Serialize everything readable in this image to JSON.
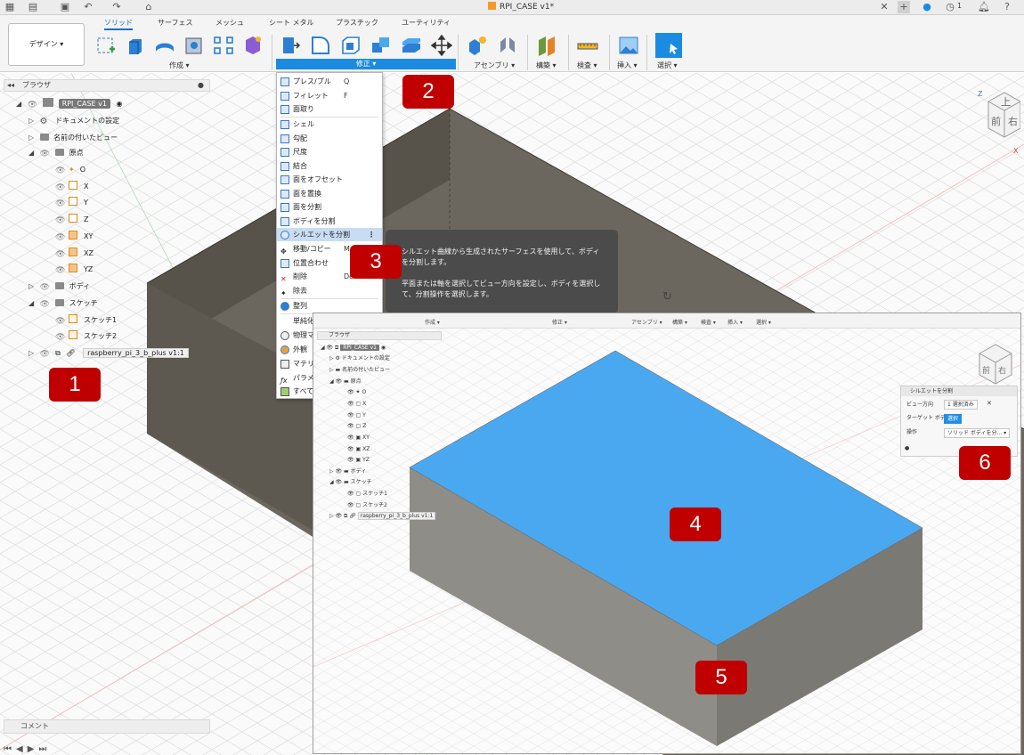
{
  "app": {
    "document_title": "RPI_CASE v1*",
    "notification_count": "1"
  },
  "ribbon": {
    "design_label": "デザイン ▾",
    "tabs": [
      "ソリッド",
      "サーフェス",
      "メッシュ",
      "シート メタル",
      "プラスチック",
      "ユーティリティ"
    ],
    "groups": {
      "create": "作成 ▾",
      "modify": "修正 ▾",
      "assemble": "アセンブリ ▾",
      "construct": "構築 ▾",
      "inspect": "検査 ▾",
      "insert": "挿入 ▾",
      "select": "選択 ▾"
    }
  },
  "browser": {
    "title": "ブラウザ",
    "root": "RPI_CASE v1",
    "items": {
      "doc_settings": "ドキュメントの設定",
      "named_views": "名前の付いたビュー",
      "origin": "原点",
      "o": "O",
      "x": "X",
      "y": "Y",
      "z": "Z",
      "xy": "XY",
      "xz": "XZ",
      "yz": "YZ",
      "bodies": "ボディ",
      "sketches": "スケッチ",
      "sketch1": "スケッチ1",
      "sketch2": "スケッチ2",
      "component": "raspberry_pi_3_b_plus v1:1"
    }
  },
  "comment_label": "コメント",
  "menu": {
    "items": [
      {
        "label": "プレス/プル",
        "shortcut": "Q"
      },
      {
        "label": "フィレット",
        "shortcut": "F"
      },
      {
        "label": "面取り",
        "shortcut": ""
      },
      {
        "label": "シェル",
        "shortcut": ""
      },
      {
        "label": "勾配",
        "shortcut": ""
      },
      {
        "label": "尺度",
        "shortcut": ""
      },
      {
        "label": "結合",
        "shortcut": ""
      },
      {
        "label": "面をオフセット",
        "shortcut": ""
      },
      {
        "label": "面を置換",
        "shortcut": ""
      },
      {
        "label": "面を分割",
        "shortcut": ""
      },
      {
        "label": "ボディを分割",
        "shortcut": ""
      },
      {
        "label": "シルエットを分割",
        "shortcut": ""
      },
      {
        "label": "移動/コピー",
        "shortcut": "M"
      },
      {
        "label": "位置合わせ",
        "shortcut": ""
      },
      {
        "label": "削除",
        "shortcut": "De"
      },
      {
        "label": "除去",
        "shortcut": ""
      },
      {
        "label": "整列",
        "shortcut": ""
      },
      {
        "label": "単純化",
        "shortcut": ""
      },
      {
        "label": "物理マ",
        "shortcut": ""
      },
      {
        "label": "外観",
        "shortcut": ""
      },
      {
        "label": "マテリア",
        "shortcut": ""
      },
      {
        "label": "パラメー",
        "shortcut": ""
      },
      {
        "label": "すべて",
        "shortcut": ""
      }
    ]
  },
  "tooltip": {
    "line1": "シルエット曲線から生成されたサーフェスを使用して、ボディを分割します。",
    "line2": "平面または軸を選択してビュー方向を設定し、ボディを選択して、分割操作を選択します。"
  },
  "inset": {
    "toolbar": [
      "作成 ▾",
      "修正 ▾",
      "アセンブリ ▾",
      "構築 ▾",
      "検査 ▾",
      "挿入 ▾",
      "選択 ▾"
    ],
    "browser_title": "ブラウザ",
    "root": "RPI_CASE v1",
    "items": {
      "doc_settings": "ドキュメントの設定",
      "named_views": "名前の付いたビュー",
      "origin": "原点",
      "o": "O",
      "x": "X",
      "y": "Y",
      "z": "Z",
      "xy": "XY",
      "xz": "XZ",
      "yz": "YZ",
      "bodies": "ボディ",
      "sketches": "スケッチ",
      "sketch1": "スケッチ1",
      "sketch2": "スケッチ2",
      "component": "raspberry_pi_3_b_plus v1:1"
    },
    "dialog": {
      "title": "シルエットを分割",
      "view_direction_label": "ビュー方向",
      "view_direction_value": "1 選択済み",
      "target_body_label": "ターゲット ボディ",
      "target_body_value": "選択",
      "operation_label": "操作",
      "operation_value": "ソリッド ボディを分... ▾"
    }
  },
  "viewcube": {
    "top": "上",
    "front": "前",
    "right": "右",
    "z": "Z",
    "x": "X"
  },
  "callouts": [
    "1",
    "2",
    "3",
    "4",
    "5",
    "6"
  ],
  "colors": {
    "accent": "#1a8be0",
    "face_selected": "#4aa8f0",
    "callout": "#c00000",
    "body_dark": "#6b675e"
  }
}
